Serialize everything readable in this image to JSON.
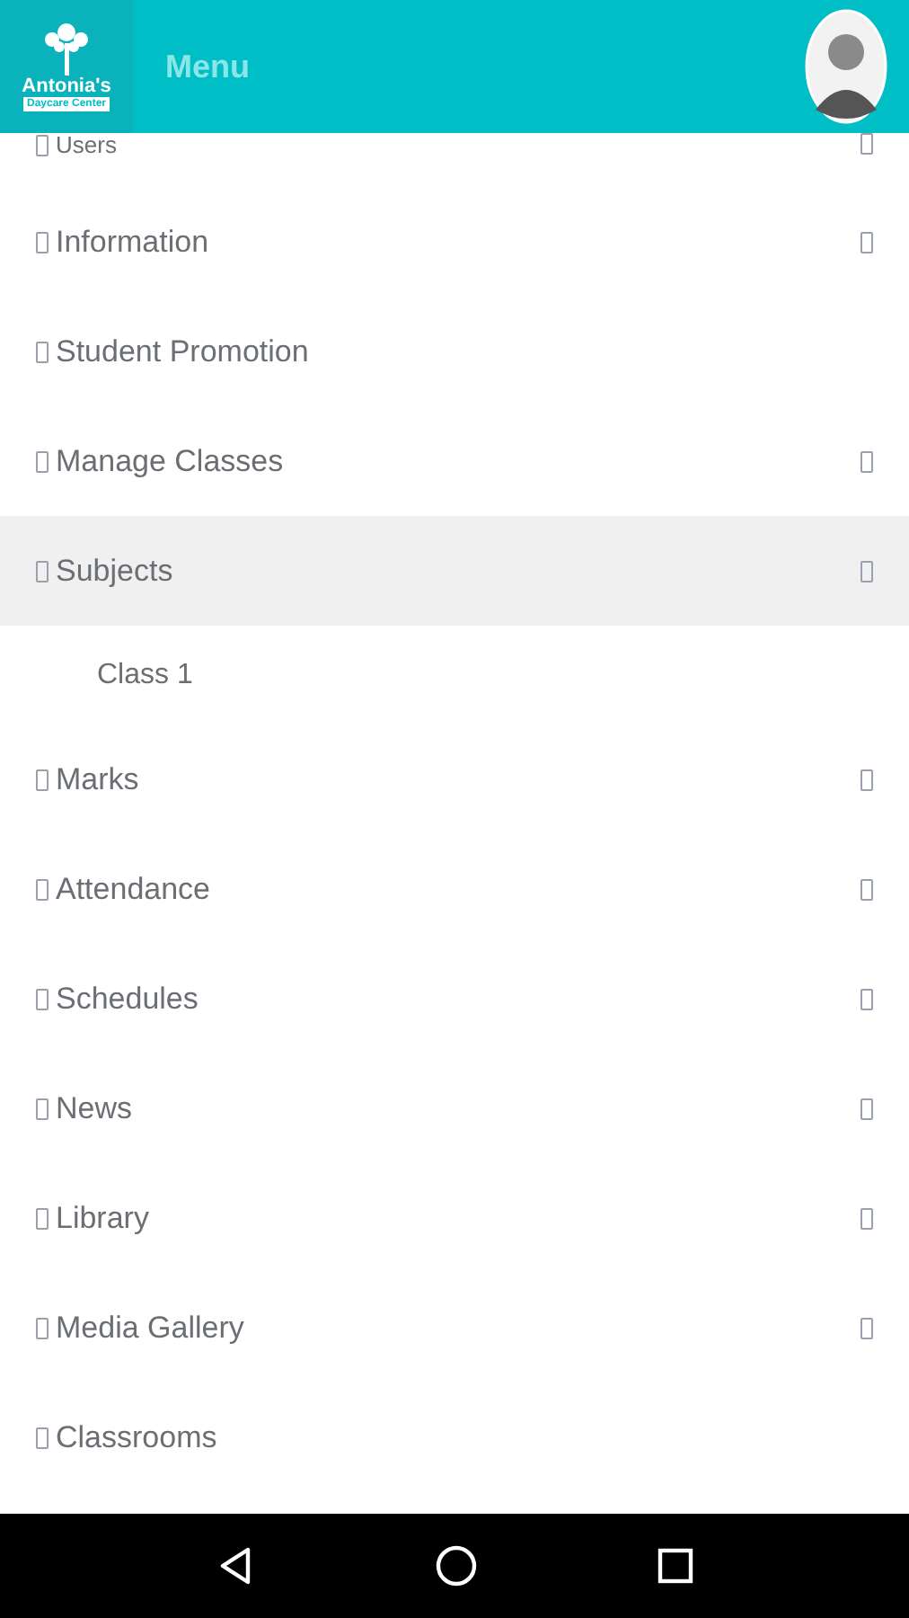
{
  "header": {
    "logo": {
      "name": "Antonia's",
      "tagline": "Daycare Center"
    },
    "title": "Menu"
  },
  "menu": [
    {
      "label": "Users",
      "has_arrow": true,
      "selected": false
    },
    {
      "label": "Information",
      "has_arrow": true,
      "selected": false
    },
    {
      "label": "Student Promotion",
      "has_arrow": false,
      "selected": false
    },
    {
      "label": "Manage Classes",
      "has_arrow": true,
      "selected": false
    },
    {
      "label": "Subjects",
      "has_arrow": true,
      "selected": true,
      "expanded": true,
      "children": [
        {
          "label": "Class 1"
        }
      ]
    },
    {
      "label": "Marks",
      "has_arrow": true,
      "selected": false
    },
    {
      "label": "Attendance",
      "has_arrow": true,
      "selected": false
    },
    {
      "label": "Schedules",
      "has_arrow": true,
      "selected": false
    },
    {
      "label": "News",
      "has_arrow": true,
      "selected": false
    },
    {
      "label": "Library",
      "has_arrow": true,
      "selected": false
    },
    {
      "label": "Media Gallery",
      "has_arrow": true,
      "selected": false
    },
    {
      "label": "Classrooms",
      "has_arrow": false,
      "selected": false
    }
  ]
}
